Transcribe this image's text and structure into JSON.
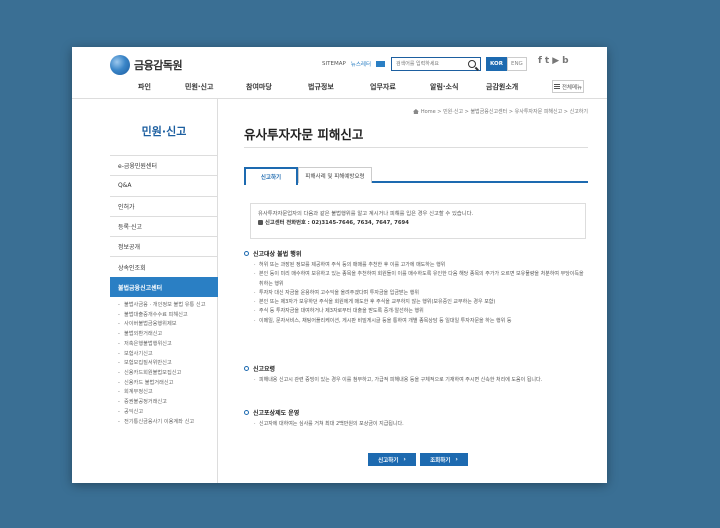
{
  "header": {
    "logo_text": "금융감독원",
    "sitemap": "SITEMAP",
    "news": "뉴스레터",
    "search_placeholder": "검색어를 입력하세요",
    "lang_kor": "KOR",
    "lang_eng": "ENG",
    "social": [
      "f",
      "t",
      "▶",
      "b"
    ]
  },
  "gnb": {
    "items": [
      "파인",
      "민원·신고",
      "참여마당",
      "법규정보",
      "업무자료",
      "알림·소식",
      "금감원소개"
    ],
    "allmenu": "전체메뉴"
  },
  "lnb": {
    "title": "민원·신고",
    "items": [
      "e-금융민원센터",
      "Q&A",
      "인허가",
      "등록·신고",
      "정보공개",
      "상속인조회",
      "불법금융신고센터"
    ],
    "sub_items": [
      "불법사금융 · 개인정보 불법 유통 신고",
      "불법대출중개수수료 피해신고",
      "사이버불법금융행위제보",
      "불법외환거래신고",
      "저축은행불법행위신고",
      "보험사기신고",
      "보험모집질서위반신고",
      "신용카드회원불법모집신고",
      "신용카드 불법거래신고",
      "회계부정신고",
      "증권불공정거래신고",
      "공익신고",
      "전기통신금융사기 이용계좌 신고"
    ]
  },
  "content": {
    "breadcrumb": [
      "Home",
      "민원·신고",
      "불법금융신고센터",
      "유사투자자문 피해신고",
      "신고하기"
    ],
    "title": "유사투자자문 피해신고",
    "tabs": [
      "신고하기",
      "피해사례 및 피해예방요령"
    ],
    "intro_text": "유사투자자문업자의 다음과 같은 불법행위를 알고 계시거나 피해를 입은 경우 신고할 수 있습니다.",
    "phone_label": "신고센터 전화번호 : 02)3145-7646, 7634, 7647, 7694",
    "sections": [
      {
        "title": "신고대상 불법 행위",
        "items": [
          "허위 또는 과장된 정보를 제공하여 주식 등의 매매를 추천한 후 이를 고가에 매도하는 행위",
          "본인 등이 미리 매수하여 보유하고 있는 종목을 추천하여 회원들이 이를 매수하도록 유인한 다음 해당 종목의 주가가 오르면 보유물량을 처분하여 부당이득을 취하는 행위",
          "투자자 대신 자금을 운용하여 고수익을 올려주겠다며 투자금을 입금받는 행위",
          "본인 또는 제3자가 보유하던 주식을 회원에게 매도한 후 주식을 교부하지 않는 행위(보유중인 교부하는 경우 포함)",
          "주식 등 투자자금을 대여하거나 제3자로부터 대출을 받도록 중개·알선하는 행위",
          "이메일, 문자서비스, 채팅어플리케이션, 게시판 비밀게시글 등을 통하여 개별 종목상담 등 일대일 투자자문을 하는 행위 등"
        ]
      },
      {
        "title": "신고요령",
        "items": [
          "피해내용 신고시 관련 증빙이 있는 경우 이를 첨부하고, 가급적 피해내용 등을 구체적으로 기재하여 주시면 신속한 처리에 도움이 됩니다."
        ]
      },
      {
        "title": "신고포상제도 운영",
        "items": [
          "신고자에 대하여는 심사를 거쳐 최대 2백만원의 포상금이 지급됩니다."
        ]
      }
    ],
    "buttons": [
      "신고하기",
      "조회하기"
    ]
  },
  "colors": {
    "background": "#3a6f94",
    "primary": "#1d6ab0",
    "active_nav": "#2a7fc4"
  }
}
